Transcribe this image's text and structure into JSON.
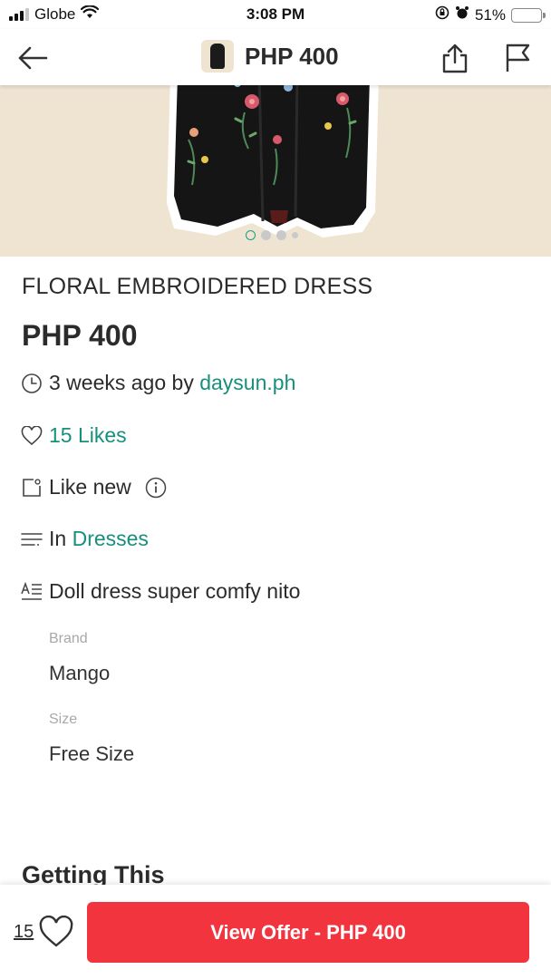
{
  "status_bar": {
    "carrier": "Globe",
    "time": "3:08 PM",
    "battery": "51%",
    "battery_level": 0.51,
    "icons": [
      "signal-icon",
      "wifi-icon",
      "orientation-lock-icon",
      "alarm-icon",
      "battery-icon"
    ]
  },
  "header": {
    "price": "PHP 400",
    "icons": [
      "back-arrow-icon",
      "share-icon",
      "flag-icon"
    ]
  },
  "gallery": {
    "total_images": 4,
    "active_index": 0
  },
  "listing": {
    "title": "FLORAL EMBROIDERED DRESS",
    "price": "PHP 400",
    "posted_prefix": "3 weeks ago by ",
    "seller": "daysun.ph",
    "likes_label": "15 Likes",
    "condition": "Like new",
    "category_prefix": "In ",
    "category": "Dresses",
    "description": "Doll dress super comfy nito",
    "details": [
      {
        "label": "Brand",
        "value": "Mango"
      },
      {
        "label": "Size",
        "value": "Free Size"
      }
    ],
    "section_title": "Getting This"
  },
  "bottom_bar": {
    "like_count": "15",
    "offer_button": "View Offer - PHP 400"
  },
  "colors": {
    "accent_teal": "#178f7c",
    "offer_red": "#f2343f",
    "photo_bg": "#efe4d2"
  }
}
